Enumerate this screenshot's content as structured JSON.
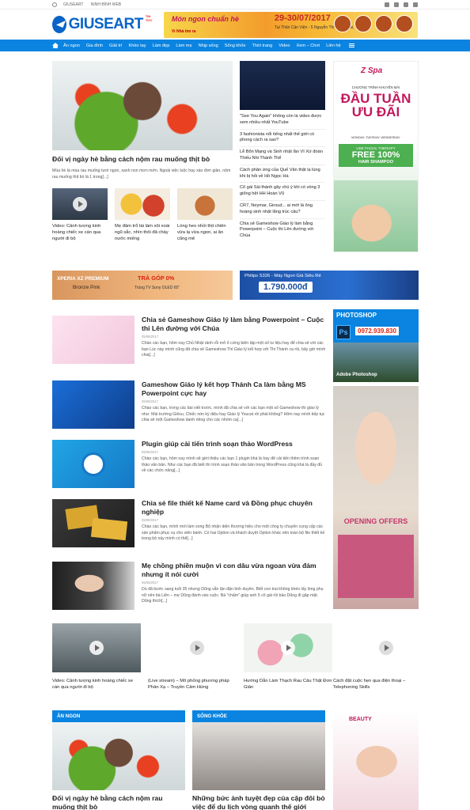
{
  "topbar": {
    "links": [
      "GIUSEART",
      "NINH BÌNH WEB"
    ],
    "social": [
      "facebook-icon",
      "rss-icon",
      "youtube-icon",
      "google-plus-icon"
    ]
  },
  "header": {
    "logo_name": "GIUSEART",
    "logo_sub": "TIN TỨC",
    "banner": {
      "tagline": "Món ngon chuẩn hè",
      "dates": "29-30/07/2017",
      "place": "Tại Thân Cận Viện - 5 Nguyễn Thị Minh Khai, Quận 1",
      "brand": "Vì Nhà tìm ra"
    }
  },
  "nav": {
    "items": [
      "Ăn ngon",
      "Gia đình",
      "Giải trí",
      "Khéo tay",
      "Làm đẹp",
      "Làm mẹ",
      "Nhịp sống",
      "Sống khỏe",
      "Thời trang",
      "Video",
      "Xem – Chơi",
      "Liên hệ"
    ]
  },
  "featured": {
    "title": "Đối vị ngày hè bằng cách nộm rau muống thịt bò",
    "desc": "Mùa hè là mùa rau muống tươi ngon, xanh non mơn mởn. Ngoài việc luộc hay xào đơn giản, nộm rau muống thịt bò là 1 trong[...]"
  },
  "featured_small": [
    {
      "title": "Video: Cảnh tượng kinh hoàng chiếc xe cán qua người đi bộ"
    },
    {
      "title": "Mẹ đảm trổ tài làm xôi xoài ngũ sắc, nhìn thôi đã chảy nước miếng"
    },
    {
      "title": "Lòng heo nhồi thịt chiên vừa lạ vừa ngon, ai ăn cũng mê"
    }
  ],
  "side_news": {
    "lead": "\"See You Again\" không còn là video được xem nhiều nhất YouTube",
    "items": [
      "3 fashionista nổi tiếng nhất thế giới có phong cách ra sao?",
      "Lễ Bổn Mạng và Sinh nhật lần VI Xứ đoàn Thiếu Nhi Thánh Thể",
      "Cách phân ứng của Quế Vân thật lạ lùng khi bị hỏi về Hồ Ngọc Hà",
      "Cô gái Sài thành gây chú ý khi có vòng 3 giống hệt HH Hoàn Vũ",
      "CR7, Neymar, Giroud... ai mới là ông hoàng sinh nhật lãng trúc câu?",
      "Chia sẻ Gameshow Giáo lý làm bằng Powerpoint – Cuộc thi Lên đường với Chúa"
    ]
  },
  "ads": {
    "spa": {
      "brand": "Z Spa",
      "line1": "CHƯƠNG TRÌNH KHUYẾN MÃI",
      "big": "ĐẦU TUẦN ƯU ĐÃI",
      "days": "MONDAY, TUESDAY, WEDNESDAY",
      "offer1": "USE FACIAL THERAPY",
      "offer2": "FREE 100%",
      "offer3": "HAIR SHAMPOO"
    },
    "xperia": {
      "line1": "XPERIA XZ PREMIUM",
      "line2": "Bronze Pink",
      "line3": "TRẢ GÓP 0%",
      "line4": "Trúng TV Sony OLED 65\""
    },
    "philips": {
      "line1": "Philips S326 - Máy Ngon Giá Siêu Rẻ",
      "price": "1.790.000đ"
    },
    "photoshop": {
      "title": "PHOTOSHOP",
      "phone": "0972.939.830",
      "course": "Adobe Photoshop"
    },
    "opening": {
      "title": "OPENING OFFERS"
    },
    "beauty": {
      "brand": "BEAUTY"
    }
  },
  "articles": [
    {
      "title": "Chia sẻ Gameshow Giáo lý làm bằng Powerpoint – Cuộc thi Lên đường với Chúa",
      "date": "05/08/2017",
      "desc": "Chào các bạn, hôm nay Chủ Nhật rảnh rỗi mở ổ cứng biên tập một số tư liệu hay để chia sẻ với các bạn  Lúc này mình cũng đã chia sẻ Gameshow Thi Giáo lý kết hợp với Thi Thánh ca rồi, bây giờ mình chia[...]"
    },
    {
      "title": "Gameshow Giáo lý kết hợp Thánh Ca làm bằng MS Powerpoint cực hay",
      "date": "05/08/2017",
      "desc": "Chào các bạn, trong các bài viết trước, mình đã chia sẻ với các bạn một số Gameshow thi giáo lý như: Mái trường Giêsu, Chiếc nón kỳ diệu hay Giáo lý Youcat rồi phải không? Hôm nay mình tiếp tục chia sẻ một Gameshow danh riêng cho các nhóm ca[...]"
    },
    {
      "title": "Plugin giúp cải tiến trình soạn thảo WordPress",
      "date": "05/08/2017",
      "desc": "Chào các bạn, hôm nay mình sẽ giới thiệu các bạn 1 plugin khá là hay để cải tiến thêm trình soạn thảo văn bản. Như các bạn đã biết thì trình soạn thảo văn bản trong WordPress cũng khá là đầy đủ về các chức năng[...]"
    },
    {
      "title": "Chia sẻ file thiết kế Name card và Đồng phục chuyên nghiệp",
      "date": "05/08/2017",
      "desc": "Chào các bạn, mình mới làm xong Bộ nhận diện thương hiệu cho một công ty chuyên cung cấp các sản phẩm phục vụ cho viên bánh. Có hai Option và khách duyệt Option khác nên toàn bộ file thiết kế trong bộ này mình có thể[...]"
    },
    {
      "title": "Mẹ chồng phiền muộn vì con dâu vừa ngoan vừa đảm nhưng ít nói cười",
      "date": "05/08/2017",
      "desc": "Dù đã bước sang tuổi 35 nhưng Dũng vẫn lận đận tình duyên. Biết con trai không khéo lấy lòng phụ nữ nên bà Liên – mẹ Dũng đành vào cuộc. Bà \"chấm\" giúp anh 5 cô gái rồi bảo Dũng đi gặp mặt. Dũng thích[...]"
    }
  ],
  "videos": [
    {
      "title": "Video: Cảnh tượng kinh hoàng chiếc xe cán qua người đi bộ"
    },
    {
      "title": "(Live stream) – Mô phỏng phương pháp Phản Xạ – Truyền Cảm Hứng"
    },
    {
      "title": "Hướng Dẫn Làm Thạch Rau Câu Thật Đơn Giản"
    },
    {
      "title": "Cách đặt cuộc hẹn qua điện thoại – Telephoning Skills"
    }
  ],
  "categories": [
    {
      "head": "ĂN NGON",
      "title": "Đối vị ngày hè bằng cách nộm rau muống thịt bò"
    },
    {
      "head": "SỐNG KHỎE",
      "title": "Những bức ảnh tuyệt đẹp của cặp đôi bỏ việc để du lịch vòng quanh thế giới"
    }
  ],
  "colors": {
    "brand": "#0a84e0",
    "logo": "#0a64c8"
  }
}
